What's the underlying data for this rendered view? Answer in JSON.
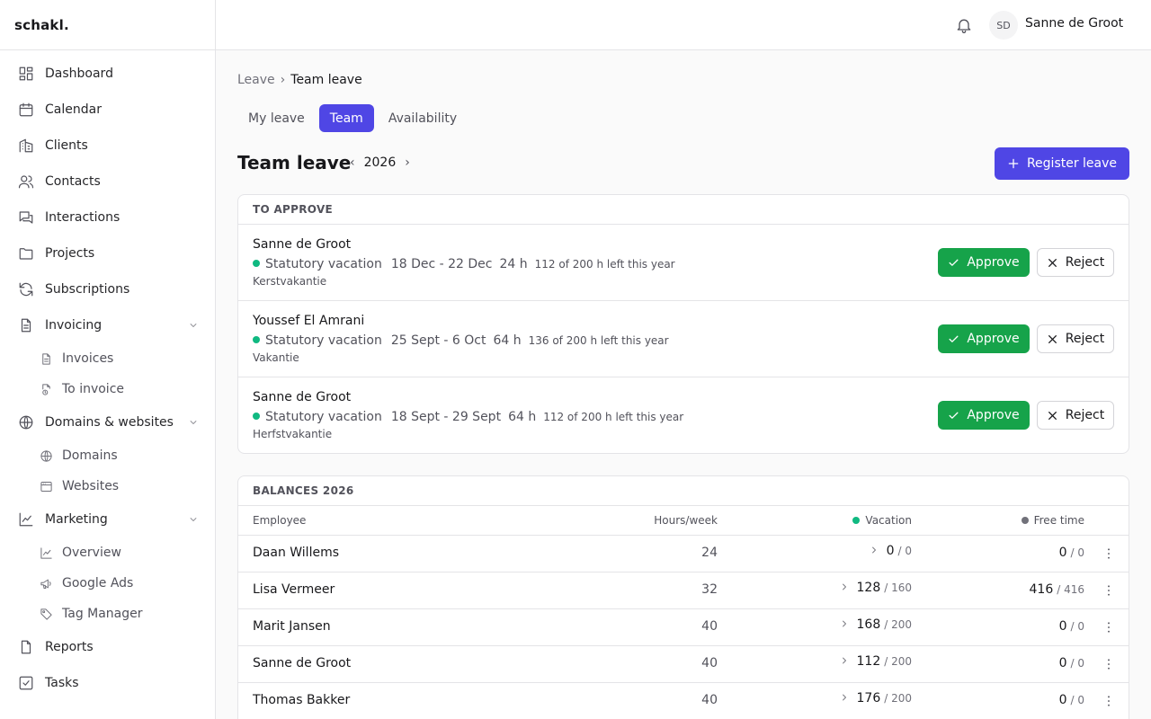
{
  "app": {
    "logo": "schakl."
  },
  "sidebar": {
    "items": [
      {
        "label": "Dashboard",
        "icon": "dashboard-icon"
      },
      {
        "label": "Calendar",
        "icon": "calendar-icon"
      },
      {
        "label": "Clients",
        "icon": "building-icon"
      },
      {
        "label": "Contacts",
        "icon": "users-icon"
      },
      {
        "label": "Interactions",
        "icon": "chat-icon"
      },
      {
        "label": "Projects",
        "icon": "folder-icon"
      },
      {
        "label": "Subscriptions",
        "icon": "refresh-icon"
      },
      {
        "label": "Invoicing",
        "icon": "file-text-icon",
        "expanded": true,
        "children": [
          {
            "label": "Invoices",
            "icon": "file-icon"
          },
          {
            "label": "To invoice",
            "icon": "file-clock-icon"
          }
        ]
      },
      {
        "label": "Domains & websites",
        "icon": "globe-icon",
        "expanded": true,
        "children": [
          {
            "label": "Domains",
            "icon": "globe-icon"
          },
          {
            "label": "Websites",
            "icon": "browser-icon"
          }
        ]
      },
      {
        "label": "Marketing",
        "icon": "chart-line-icon",
        "expanded": true,
        "children": [
          {
            "label": "Overview",
            "icon": "chart-line-icon"
          },
          {
            "label": "Google Ads",
            "icon": "megaphone-icon"
          },
          {
            "label": "Tag Manager",
            "icon": "tag-icon"
          }
        ]
      },
      {
        "label": "Reports",
        "icon": "file-icon"
      },
      {
        "label": "Tasks",
        "icon": "check-square-icon"
      }
    ]
  },
  "topbar": {
    "user_initials": "SD",
    "user_name": "Sanne de Groot"
  },
  "breadcrumb": {
    "parent": "Leave",
    "separator": "›",
    "current": "Team leave"
  },
  "tabs": [
    {
      "label": "My leave",
      "active": false
    },
    {
      "label": "Team",
      "active": true
    },
    {
      "label": "Availability",
      "active": false
    }
  ],
  "header": {
    "title": "Team leave",
    "prev": "‹",
    "year": "2026",
    "next": "›",
    "register_label": "Register leave"
  },
  "approve": {
    "heading": "TO APPROVE",
    "approve_label": "Approve",
    "reject_label": "Reject",
    "requests": [
      {
        "name": "Sanne de Groot",
        "type": "Statutory vacation",
        "dates": "18 Dec - 22 Dec",
        "hours": "24 h",
        "left": "112 of 200 h left this year",
        "note": "Kerstvakantie"
      },
      {
        "name": "Youssef El Amrani",
        "type": "Statutory vacation",
        "dates": "25 Sept - 6 Oct",
        "hours": "64 h",
        "left": "136 of 200 h left this year",
        "note": "Vakantie"
      },
      {
        "name": "Sanne de Groot",
        "type": "Statutory vacation",
        "dates": "18 Sept - 29 Sept",
        "hours": "64 h",
        "left": "112 of 200 h left this year",
        "note": "Herfstvakantie"
      }
    ]
  },
  "balances": {
    "heading": "BALANCES 2026",
    "columns": {
      "employee": "Employee",
      "hours": "Hours/week",
      "vacation": "Vacation",
      "free_time": "Free time"
    },
    "colors": {
      "vacation": "#10b981",
      "free_time": "#71717a"
    },
    "rows": [
      {
        "name": "Daan Willems",
        "hours": "24",
        "vac_used": "0",
        "vac_total": "/ 0",
        "free_used": "0",
        "free_total": "/ 0"
      },
      {
        "name": "Lisa Vermeer",
        "hours": "32",
        "vac_used": "128",
        "vac_total": "/ 160",
        "free_used": "416",
        "free_total": "/ 416"
      },
      {
        "name": "Marit Jansen",
        "hours": "40",
        "vac_used": "168",
        "vac_total": "/ 200",
        "free_used": "0",
        "free_total": "/ 0"
      },
      {
        "name": "Sanne de Groot",
        "hours": "40",
        "vac_used": "112",
        "vac_total": "/ 200",
        "free_used": "0",
        "free_total": "/ 0"
      },
      {
        "name": "Thomas Bakker",
        "hours": "40",
        "vac_used": "176",
        "vac_total": "/ 200",
        "free_used": "0",
        "free_total": "/ 0"
      }
    ]
  }
}
